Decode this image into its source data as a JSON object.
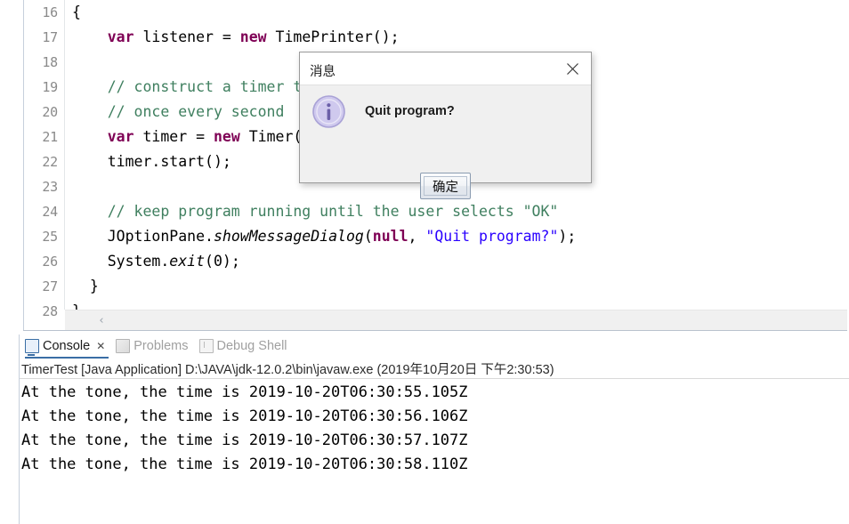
{
  "editor": {
    "first_line_number": 16,
    "lines": [
      {
        "num": "16",
        "indent": 0,
        "tokens": [
          {
            "t": "plain",
            "v": "{"
          }
        ]
      },
      {
        "num": "17",
        "indent": 0,
        "tokens": [
          {
            "t": "plain",
            "v": "    "
          },
          {
            "t": "keyword",
            "v": "var"
          },
          {
            "t": "plain",
            "v": " listener = "
          },
          {
            "t": "keyword",
            "v": "new"
          },
          {
            "t": "plain",
            "v": " TimePrinter();"
          }
        ]
      },
      {
        "num": "18",
        "indent": 0,
        "tokens": [
          {
            "t": "plain",
            "v": ""
          }
        ]
      },
      {
        "num": "19",
        "indent": 0,
        "tokens": [
          {
            "t": "comment",
            "v": "    // construct a timer that calls the listener"
          }
        ]
      },
      {
        "num": "20",
        "indent": 0,
        "tokens": [
          {
            "t": "comment",
            "v": "    // once every second"
          }
        ]
      },
      {
        "num": "21",
        "indent": 0,
        "tokens": [
          {
            "t": "plain",
            "v": "    "
          },
          {
            "t": "keyword",
            "v": "var"
          },
          {
            "t": "plain",
            "v": " timer = "
          },
          {
            "t": "keyword",
            "v": "new"
          },
          {
            "t": "plain",
            "v": " Timer(1000, listener);"
          }
        ]
      },
      {
        "num": "22",
        "indent": 0,
        "tokens": [
          {
            "t": "plain",
            "v": "    timer.start();"
          }
        ]
      },
      {
        "num": "23",
        "indent": 0,
        "tokens": [
          {
            "t": "plain",
            "v": ""
          }
        ]
      },
      {
        "num": "24",
        "indent": 0,
        "tokens": [
          {
            "t": "comment",
            "v": "    // keep program running until the user selects \"OK\""
          }
        ]
      },
      {
        "num": "25",
        "indent": 0,
        "tokens": [
          {
            "t": "plain",
            "v": "    JOptionPane."
          },
          {
            "t": "method",
            "v": "showMessageDialog"
          },
          {
            "t": "plain",
            "v": "("
          },
          {
            "t": "null",
            "v": "null"
          },
          {
            "t": "plain",
            "v": ", "
          },
          {
            "t": "string",
            "v": "\"Quit program?\""
          },
          {
            "t": "plain",
            "v": ");"
          }
        ]
      },
      {
        "num": "26",
        "indent": 0,
        "tokens": [
          {
            "t": "plain",
            "v": "    System."
          },
          {
            "t": "method",
            "v": "exit"
          },
          {
            "t": "plain",
            "v": "(0);"
          }
        ]
      },
      {
        "num": "27",
        "indent": 0,
        "tokens": [
          {
            "t": "plain",
            "v": "  }"
          }
        ]
      },
      {
        "num": "28",
        "indent": 0,
        "tokens": [
          {
            "t": "plain",
            "v": "}"
          }
        ]
      }
    ],
    "hscroll_arrow": "‹",
    "colors": {
      "keyword": "#7F0055",
      "comment": "#3F7F5F",
      "string": "#2A00FF",
      "plain": "#000000"
    }
  },
  "console": {
    "tabs": [
      {
        "label": "Console",
        "icon": "console-icon",
        "active": true,
        "closable": true,
        "close_glyph": "✕"
      },
      {
        "label": "Problems",
        "icon": "problems-icon",
        "active": false,
        "closable": false,
        "close_glyph": ""
      },
      {
        "label": "Debug Shell",
        "icon": "debug-shell-icon",
        "active": false,
        "closable": false,
        "close_glyph": ""
      }
    ],
    "launch_line": "TimerTest [Java Application] D:\\JAVA\\jdk-12.0.2\\bin\\javaw.exe (2019年10月20日 下午2:30:53)",
    "output": [
      "At the tone, the time is 2019-10-20T06:30:55.105Z",
      "At the tone, the time is 2019-10-20T06:30:56.106Z",
      "At the tone, the time is 2019-10-20T06:30:57.107Z",
      "At the tone, the time is 2019-10-20T06:30:58.110Z"
    ]
  },
  "dialog": {
    "title": "消息",
    "close_label": "close",
    "message": "Quit program?",
    "button_label": "确定",
    "icon": "info-icon",
    "colors": {
      "titlebar_bg": "#FFFFFF",
      "body_bg": "#F0F0F0",
      "info_circle": "#C9C3EA",
      "info_glyph": "#6B5FA8",
      "border": "#9B9B9B"
    }
  }
}
